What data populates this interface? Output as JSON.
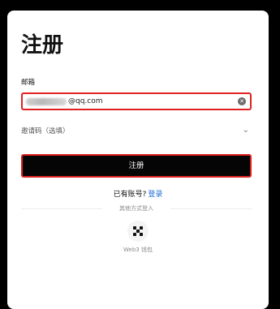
{
  "form": {
    "title": "注册",
    "email_label": "邮箱",
    "email_value_suffix": "@qq.com",
    "invite_label": "邀请码（选填）",
    "register_label": "注册"
  },
  "login": {
    "prompt": "已有账号?",
    "link": "登录"
  },
  "alt_login": {
    "divider_text": "其他方式登入",
    "web3_label": "Web3 钱包",
    "web3_icon": "web3-wallet-icon"
  },
  "colors": {
    "highlight": "#e02020",
    "button_bg": "#050505",
    "link": "#1a6ad8",
    "page_bg": "#000000"
  }
}
